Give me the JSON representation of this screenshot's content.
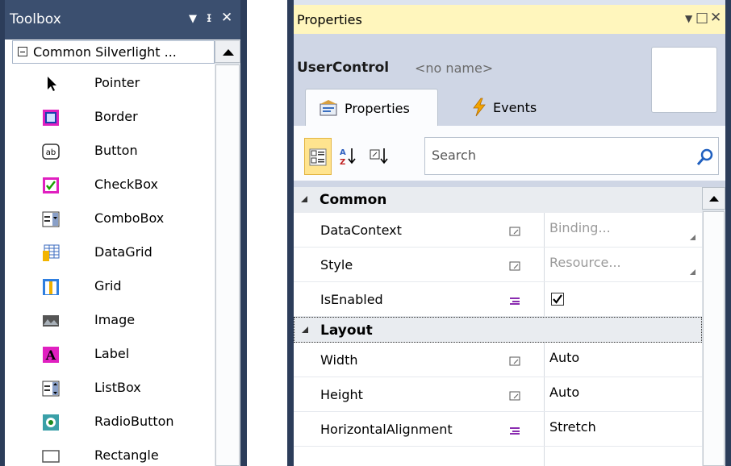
{
  "toolbox": {
    "title": "Toolbox",
    "title_icons": [
      "dropdown-icon",
      "pin-icon",
      "close-icon"
    ],
    "category_label": "Common Silverlight ...",
    "items": [
      {
        "label": "Pointer",
        "icon": "pointer-icon"
      },
      {
        "label": "Border",
        "icon": "border-icon"
      },
      {
        "label": "Button",
        "icon": "button-icon"
      },
      {
        "label": "CheckBox",
        "icon": "checkbox-icon"
      },
      {
        "label": "ComboBox",
        "icon": "combobox-icon"
      },
      {
        "label": "DataGrid",
        "icon": "datagrid-icon"
      },
      {
        "label": "Grid",
        "icon": "grid-icon"
      },
      {
        "label": "Image",
        "icon": "image-icon"
      },
      {
        "label": "Label",
        "icon": "label-icon"
      },
      {
        "label": "ListBox",
        "icon": "listbox-icon"
      },
      {
        "label": "RadioButton",
        "icon": "radiobutton-icon"
      },
      {
        "label": "Rectangle",
        "icon": "rectangle-icon"
      }
    ],
    "button_glyph": "ab",
    "label_glyph": "A"
  },
  "properties": {
    "title": "Properties",
    "title_icons": [
      "dropdown-icon",
      "maximize-icon",
      "close-icon"
    ],
    "element_type": "UserControl",
    "element_name": "<no name>",
    "tabs": [
      {
        "label": "Properties",
        "icon": "properties-icon",
        "selected": true
      },
      {
        "label": "Events",
        "icon": "lightning-icon",
        "selected": false
      }
    ],
    "search": {
      "placeholder": "Search"
    },
    "toolbar_icons": [
      "categorized-icon",
      "sort-az-icon",
      "sort-source-icon"
    ],
    "categories": [
      {
        "label": "Common",
        "rows": [
          {
            "name": "DataContext",
            "value": "Binding...",
            "marker": "property-marker-icon"
          },
          {
            "name": "Style",
            "value": "Resource...",
            "marker": "property-marker-icon"
          },
          {
            "name": "IsEnabled",
            "value": "checked",
            "marker": "enum-marker-icon"
          }
        ]
      },
      {
        "label": "Layout",
        "rows": [
          {
            "name": "Width",
            "value": "Auto",
            "marker": "property-marker-icon"
          },
          {
            "name": "Height",
            "value": "Auto",
            "marker": "property-marker-icon"
          },
          {
            "name": "HorizontalAlignment",
            "value": "Stretch",
            "marker": "enum-marker-icon"
          }
        ]
      }
    ]
  },
  "colors": {
    "frame_dark": "#2c3d5a",
    "toolbox_title": "#3b4f6f",
    "properties_title": "#fff6bd",
    "selected_button": "#ffe48f"
  }
}
